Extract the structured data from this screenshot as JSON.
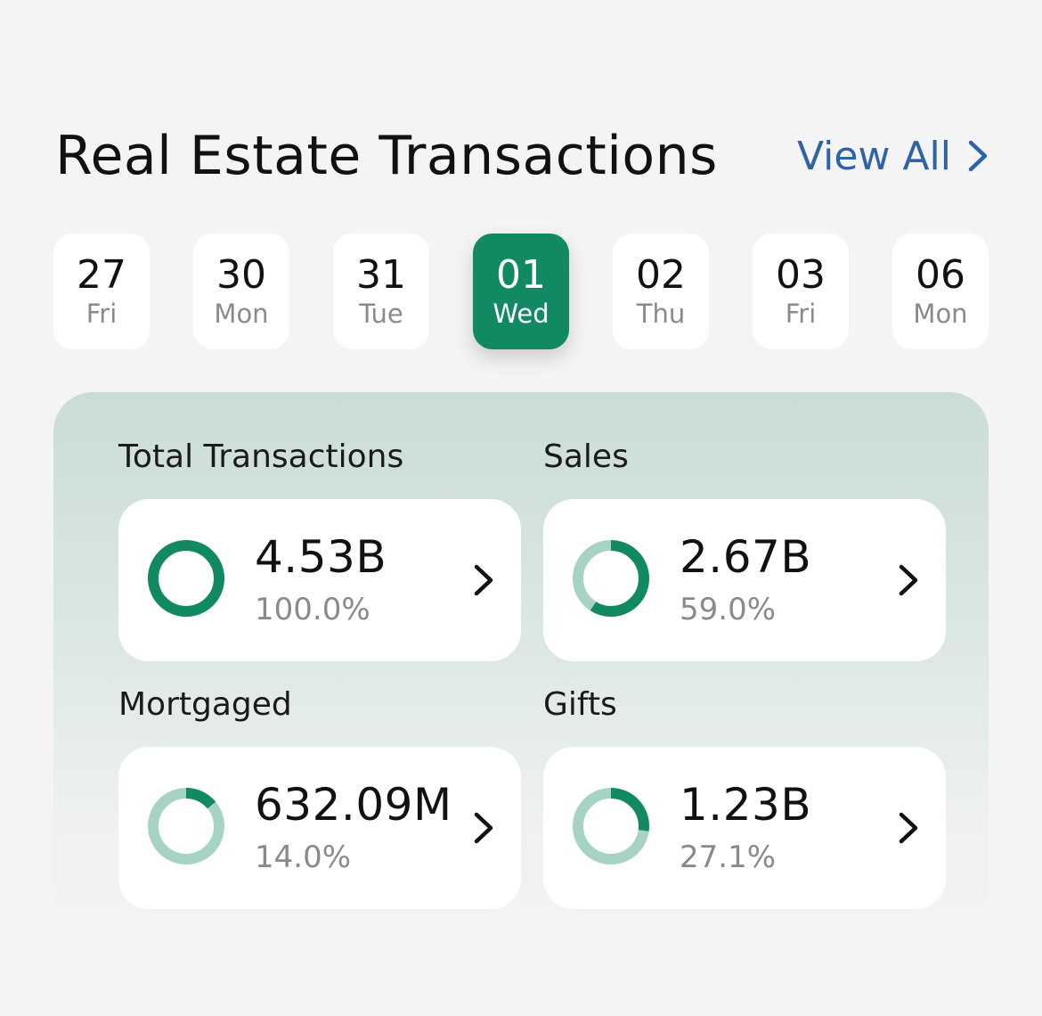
{
  "header": {
    "title": "Real Estate Transactions",
    "view_all_label": "View All"
  },
  "dates": [
    {
      "num": "27",
      "day": "Fri",
      "selected": false
    },
    {
      "num": "30",
      "day": "Mon",
      "selected": false
    },
    {
      "num": "31",
      "day": "Tue",
      "selected": false
    },
    {
      "num": "01",
      "day": "Wed",
      "selected": true
    },
    {
      "num": "02",
      "day": "Thu",
      "selected": false
    },
    {
      "num": "03",
      "day": "Fri",
      "selected": false
    },
    {
      "num": "06",
      "day": "Mon",
      "selected": false
    }
  ],
  "stats": [
    {
      "label": "Total Transactions",
      "value": "4.53B",
      "percent": "100.0%",
      "fraction": 1.0
    },
    {
      "label": "Sales",
      "value": "2.67B",
      "percent": "59.0%",
      "fraction": 0.59
    },
    {
      "label": "Mortgaged",
      "value": "632.09M",
      "percent": "14.0%",
      "fraction": 0.14
    },
    {
      "label": "Gifts",
      "value": "1.23B",
      "percent": "27.1%",
      "fraction": 0.271
    }
  ],
  "colors": {
    "accent": "#118a63",
    "ring_track": "#a6d3c4",
    "link": "#2e63a8"
  },
  "icons": {
    "view_all": "chevron-right-icon",
    "card": "chevron-right-icon",
    "ring": "donut-ring-icon"
  }
}
